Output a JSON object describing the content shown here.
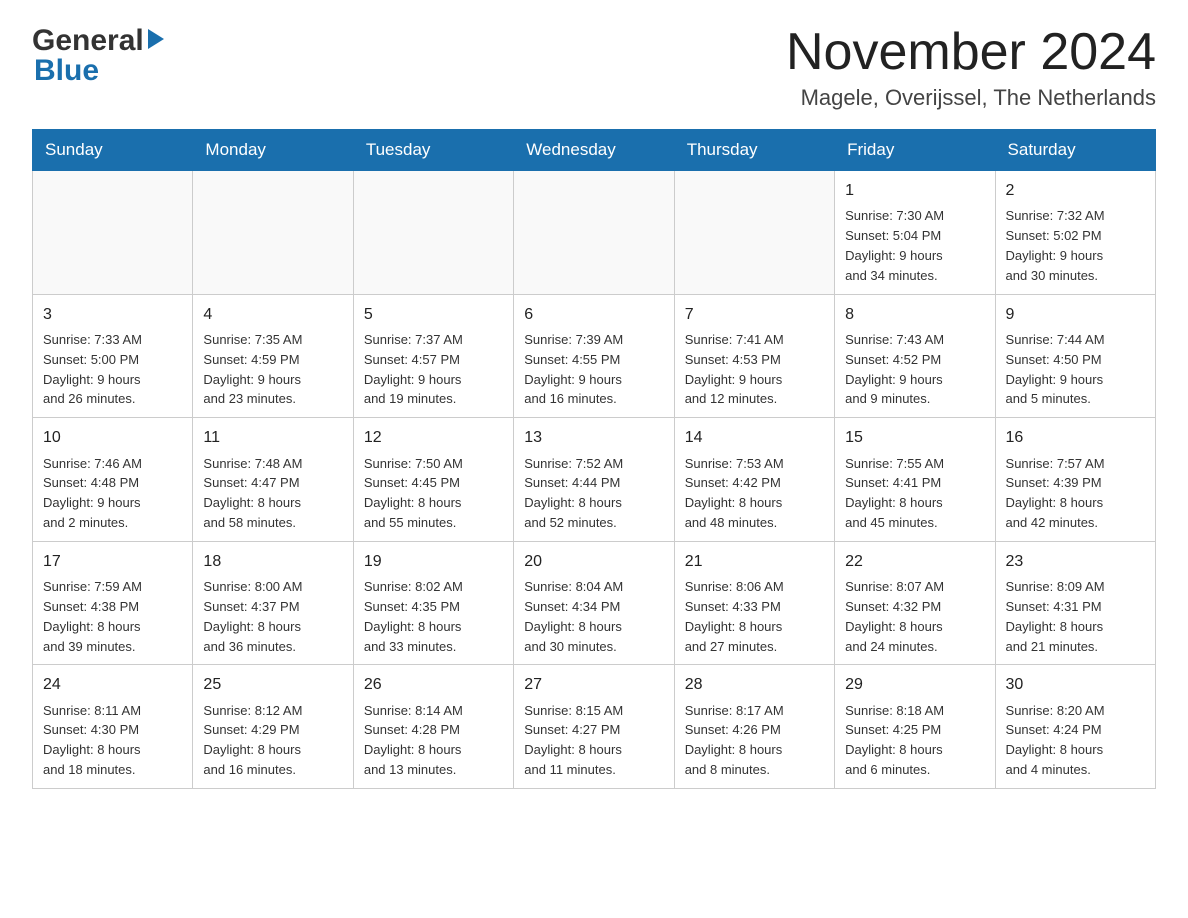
{
  "header": {
    "logo_general": "General",
    "logo_blue": "Blue",
    "month_title": "November 2024",
    "subtitle": "Magele, Overijssel, The Netherlands"
  },
  "calendar": {
    "days_of_week": [
      "Sunday",
      "Monday",
      "Tuesday",
      "Wednesday",
      "Thursday",
      "Friday",
      "Saturday"
    ],
    "weeks": [
      [
        {
          "day": "",
          "info": ""
        },
        {
          "day": "",
          "info": ""
        },
        {
          "day": "",
          "info": ""
        },
        {
          "day": "",
          "info": ""
        },
        {
          "day": "",
          "info": ""
        },
        {
          "day": "1",
          "info": "Sunrise: 7:30 AM\nSunset: 5:04 PM\nDaylight: 9 hours\nand 34 minutes."
        },
        {
          "day": "2",
          "info": "Sunrise: 7:32 AM\nSunset: 5:02 PM\nDaylight: 9 hours\nand 30 minutes."
        }
      ],
      [
        {
          "day": "3",
          "info": "Sunrise: 7:33 AM\nSunset: 5:00 PM\nDaylight: 9 hours\nand 26 minutes."
        },
        {
          "day": "4",
          "info": "Sunrise: 7:35 AM\nSunset: 4:59 PM\nDaylight: 9 hours\nand 23 minutes."
        },
        {
          "day": "5",
          "info": "Sunrise: 7:37 AM\nSunset: 4:57 PM\nDaylight: 9 hours\nand 19 minutes."
        },
        {
          "day": "6",
          "info": "Sunrise: 7:39 AM\nSunset: 4:55 PM\nDaylight: 9 hours\nand 16 minutes."
        },
        {
          "day": "7",
          "info": "Sunrise: 7:41 AM\nSunset: 4:53 PM\nDaylight: 9 hours\nand 12 minutes."
        },
        {
          "day": "8",
          "info": "Sunrise: 7:43 AM\nSunset: 4:52 PM\nDaylight: 9 hours\nand 9 minutes."
        },
        {
          "day": "9",
          "info": "Sunrise: 7:44 AM\nSunset: 4:50 PM\nDaylight: 9 hours\nand 5 minutes."
        }
      ],
      [
        {
          "day": "10",
          "info": "Sunrise: 7:46 AM\nSunset: 4:48 PM\nDaylight: 9 hours\nand 2 minutes."
        },
        {
          "day": "11",
          "info": "Sunrise: 7:48 AM\nSunset: 4:47 PM\nDaylight: 8 hours\nand 58 minutes."
        },
        {
          "day": "12",
          "info": "Sunrise: 7:50 AM\nSunset: 4:45 PM\nDaylight: 8 hours\nand 55 minutes."
        },
        {
          "day": "13",
          "info": "Sunrise: 7:52 AM\nSunset: 4:44 PM\nDaylight: 8 hours\nand 52 minutes."
        },
        {
          "day": "14",
          "info": "Sunrise: 7:53 AM\nSunset: 4:42 PM\nDaylight: 8 hours\nand 48 minutes."
        },
        {
          "day": "15",
          "info": "Sunrise: 7:55 AM\nSunset: 4:41 PM\nDaylight: 8 hours\nand 45 minutes."
        },
        {
          "day": "16",
          "info": "Sunrise: 7:57 AM\nSunset: 4:39 PM\nDaylight: 8 hours\nand 42 minutes."
        }
      ],
      [
        {
          "day": "17",
          "info": "Sunrise: 7:59 AM\nSunset: 4:38 PM\nDaylight: 8 hours\nand 39 minutes."
        },
        {
          "day": "18",
          "info": "Sunrise: 8:00 AM\nSunset: 4:37 PM\nDaylight: 8 hours\nand 36 minutes."
        },
        {
          "day": "19",
          "info": "Sunrise: 8:02 AM\nSunset: 4:35 PM\nDaylight: 8 hours\nand 33 minutes."
        },
        {
          "day": "20",
          "info": "Sunrise: 8:04 AM\nSunset: 4:34 PM\nDaylight: 8 hours\nand 30 minutes."
        },
        {
          "day": "21",
          "info": "Sunrise: 8:06 AM\nSunset: 4:33 PM\nDaylight: 8 hours\nand 27 minutes."
        },
        {
          "day": "22",
          "info": "Sunrise: 8:07 AM\nSunset: 4:32 PM\nDaylight: 8 hours\nand 24 minutes."
        },
        {
          "day": "23",
          "info": "Sunrise: 8:09 AM\nSunset: 4:31 PM\nDaylight: 8 hours\nand 21 minutes."
        }
      ],
      [
        {
          "day": "24",
          "info": "Sunrise: 8:11 AM\nSunset: 4:30 PM\nDaylight: 8 hours\nand 18 minutes."
        },
        {
          "day": "25",
          "info": "Sunrise: 8:12 AM\nSunset: 4:29 PM\nDaylight: 8 hours\nand 16 minutes."
        },
        {
          "day": "26",
          "info": "Sunrise: 8:14 AM\nSunset: 4:28 PM\nDaylight: 8 hours\nand 13 minutes."
        },
        {
          "day": "27",
          "info": "Sunrise: 8:15 AM\nSunset: 4:27 PM\nDaylight: 8 hours\nand 11 minutes."
        },
        {
          "day": "28",
          "info": "Sunrise: 8:17 AM\nSunset: 4:26 PM\nDaylight: 8 hours\nand 8 minutes."
        },
        {
          "day": "29",
          "info": "Sunrise: 8:18 AM\nSunset: 4:25 PM\nDaylight: 8 hours\nand 6 minutes."
        },
        {
          "day": "30",
          "info": "Sunrise: 8:20 AM\nSunset: 4:24 PM\nDaylight: 8 hours\nand 4 minutes."
        }
      ]
    ]
  }
}
